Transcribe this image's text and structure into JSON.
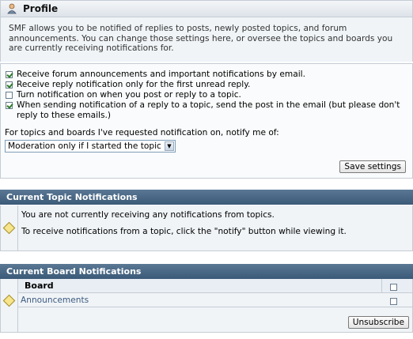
{
  "profile": {
    "title": "Profile",
    "intro": "SMF allows you to be notified of replies to posts, newly posted topics, and forum announcements. You can change those settings here, or oversee the topics and boards you are currently receiving notifications for."
  },
  "settings": {
    "options": [
      {
        "label": "Receive forum announcements and important notifications by email.",
        "checked": true
      },
      {
        "label": "Receive reply notification only for the first unread reply.",
        "checked": true
      },
      {
        "label": "Turn notification on when you post or reply to a topic.",
        "checked": false
      },
      {
        "label": "When sending notification of a reply to a topic, send the post in the email (but please don't reply to these emails.)",
        "checked": true
      }
    ],
    "notify_label": "For topics and boards I've requested notification on, notify me of:",
    "notify_selected": "Moderation only if I started the topic",
    "save_label": "Save settings"
  },
  "topic_notifications": {
    "title": "Current Topic Notifications",
    "line1": "You are not currently receiving any notifications from topics.",
    "line2": "To receive notifications from a topic, click the \"notify\" button while viewing it."
  },
  "board_notifications": {
    "title": "Current Board Notifications",
    "column_header": "Board",
    "rows": [
      {
        "name": "Announcements",
        "checked": false
      }
    ],
    "unsubscribe_label": "Unsubscribe"
  }
}
